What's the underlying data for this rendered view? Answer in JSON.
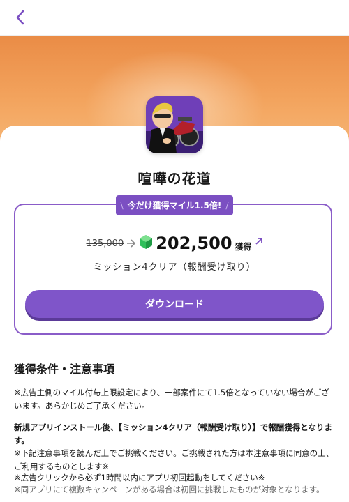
{
  "app": {
    "title": "喧嘩の花道",
    "icon": "app-icon-biker-character"
  },
  "nav": {
    "back_icon": "chevron-left-icon",
    "accent": "#7b4fc2"
  },
  "offer": {
    "badge_prefix": "\\",
    "badge_text": "今だけ獲得マイル1.5倍!",
    "badge_suffix": "/",
    "old_miles": "135,000",
    "new_miles": "202,500",
    "get_label": "獲得",
    "mission": "ミッション4クリア（報酬受け取り）",
    "download_label": "ダウンロード"
  },
  "conditions": {
    "heading": "獲得条件・注意事項",
    "notes": [
      "※広告主側のマイル付与上限設定により、一部案件にて1.5倍となっていない場合がございます。あらかじめご了承ください。",
      "新規アプリインストール後、【ミッション4クリア（報酬受け取り）】で報酬獲得となります。",
      "※下記注意事項を読んだ上でご挑戦ください。ご挑戦された方は本注意事項に同意の上、ご利用するものとします※",
      "※広告クリックから必ず1時間以内にアプリ初回起動をしてください※",
      "※同アプリにて複数キャンペーンがある場合は初回に挑戦したものが対象となります。"
    ]
  },
  "colors": {
    "hero_top": "#ea8c46",
    "hero_bottom": "#f6b878",
    "primary_button": "#7f55c9",
    "gem": "#2fbf5a"
  }
}
